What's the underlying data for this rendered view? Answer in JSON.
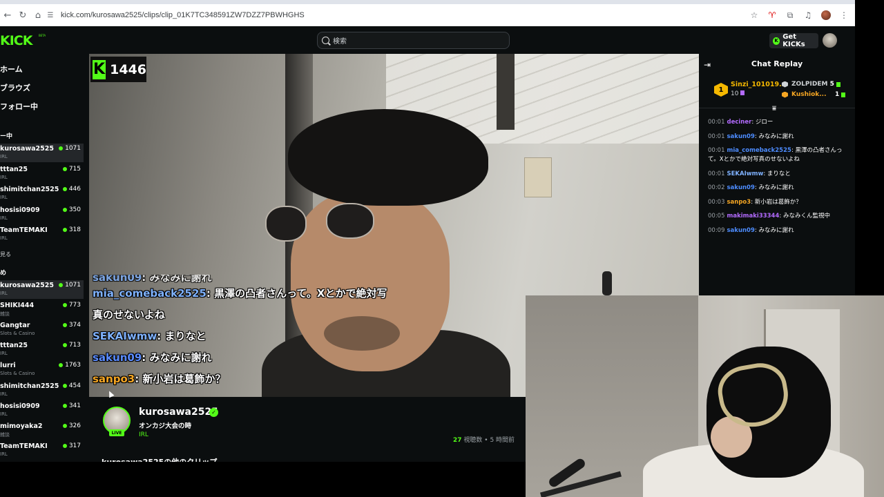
{
  "browser": {
    "url": "kick.com/kurosawa2525/clips/clip_01K7TC348591ZW7DZZ7PBWHGHS"
  },
  "topnav": {
    "logo": "KICK",
    "logo_badge": "BETA",
    "search_placeholder": "検索",
    "get_kicks_label": "Get KICKs"
  },
  "sidebar": {
    "nav": [
      "ホーム",
      "ブラウズ",
      "フォロー中"
    ],
    "following_heading": "ー中",
    "following": [
      {
        "name": "kurosawa2525",
        "category": "IRL",
        "viewers": "1071",
        "active": true
      },
      {
        "name": "tttan25",
        "category": "IRL",
        "viewers": "715"
      },
      {
        "name": "shimitchan2525",
        "category": "IRL",
        "viewers": "446"
      },
      {
        "name": "hosisi0909",
        "category": "IRL",
        "viewers": "350"
      },
      {
        "name": "TeamTEMAKI",
        "category": "IRL",
        "viewers": "318"
      }
    ],
    "show_more": "見る",
    "recommended_heading": "め",
    "recommended": [
      {
        "name": "kurosawa2525",
        "category": "IRL",
        "viewers": "1071",
        "active": true
      },
      {
        "name": "SHIKI444",
        "category": "雑談",
        "viewers": "773"
      },
      {
        "name": "Gangtar",
        "category": "Slots & Casino",
        "viewers": "374"
      },
      {
        "name": "tttan25",
        "category": "IRL",
        "viewers": "713"
      },
      {
        "name": "lurri",
        "category": "Slots & Casino",
        "viewers": "1763"
      },
      {
        "name": "shimitchan2525",
        "category": "IRL",
        "viewers": "454"
      },
      {
        "name": "hosisi0909",
        "category": "IRL",
        "viewers": "341"
      },
      {
        "name": "mimoyaka2",
        "category": "雑談",
        "viewers": "326"
      },
      {
        "name": "TeamTEMAKI",
        "category": "IRL",
        "viewers": "317"
      }
    ]
  },
  "video": {
    "badge_number": "1446",
    "overlay_chat": [
      {
        "user": "sakun09",
        "text": "みなみに謝れ",
        "color": "#7fb2ff"
      },
      {
        "user": "mia_comeback2525",
        "text": "黒澤の凸者さんって。Xとかで絶対写",
        "color": "#7fb2ff"
      },
      {
        "user": "",
        "text": "真のせないよね",
        "color": "#ffffff"
      },
      {
        "user": "SEKAIwmw",
        "text": "まりなと",
        "color": "#7fb2ff"
      },
      {
        "user": "sakun09",
        "text": "みなみに謝れ",
        "color": "#5b8cff"
      },
      {
        "user": "sanpo3",
        "text": "新小岩は葛飾か？",
        "color": "#f5a623"
      }
    ]
  },
  "clip_info": {
    "streamer": "kurosawa2525",
    "live_label": "LIVE",
    "title": "オンカジ大会の時",
    "category": "IRL",
    "views_count": "27",
    "views_label": "視聴数",
    "time_ago": "5 時間前",
    "more_clips": "kurosawa2525の他のクリップ"
  },
  "chat": {
    "title": "Chat Replay",
    "leaderboard": {
      "first": {
        "rank": "1",
        "name": "Sinzi_101019...",
        "count": "10"
      },
      "others": [
        {
          "name": "ZOLPIDEM",
          "count": "5",
          "color": "#cfd3d6"
        },
        {
          "name": "Kushiok...",
          "count": "1",
          "color": "#f5a623"
        }
      ]
    },
    "messages": [
      {
        "time": "00:01",
        "user": "deciner",
        "text": "ジロー",
        "color": "#b36bff"
      },
      {
        "time": "00:01",
        "user": "sakun09",
        "text": "みなみに謝れ",
        "color": "#4d8cff"
      },
      {
        "time": "00:01",
        "user": "mia_comeback2525",
        "text": "黒澤の凸者さんって。Xとかで絶対写真のせないよね",
        "color": "#4d8cff"
      },
      {
        "time": "00:01",
        "user": "SEKAIwmw",
        "text": "まりなと",
        "color": "#7fb2ff"
      },
      {
        "time": "00:02",
        "user": "sakun09",
        "text": "みなみに謝れ",
        "color": "#4d8cff"
      },
      {
        "time": "00:03",
        "user": "sanpo3",
        "text": "新小岩は葛飾か？",
        "color": "#f5a623"
      },
      {
        "time": "00:05",
        "user": "makimaki33344",
        "text": "みなみくん監視中",
        "color": "#b36bff"
      },
      {
        "time": "00:09",
        "user": "sakun09",
        "text": "みなみに謝れ",
        "color": "#4d8cff"
      }
    ]
  },
  "colors": {
    "accent": "#53fc18",
    "background": "#0b0e0f"
  }
}
